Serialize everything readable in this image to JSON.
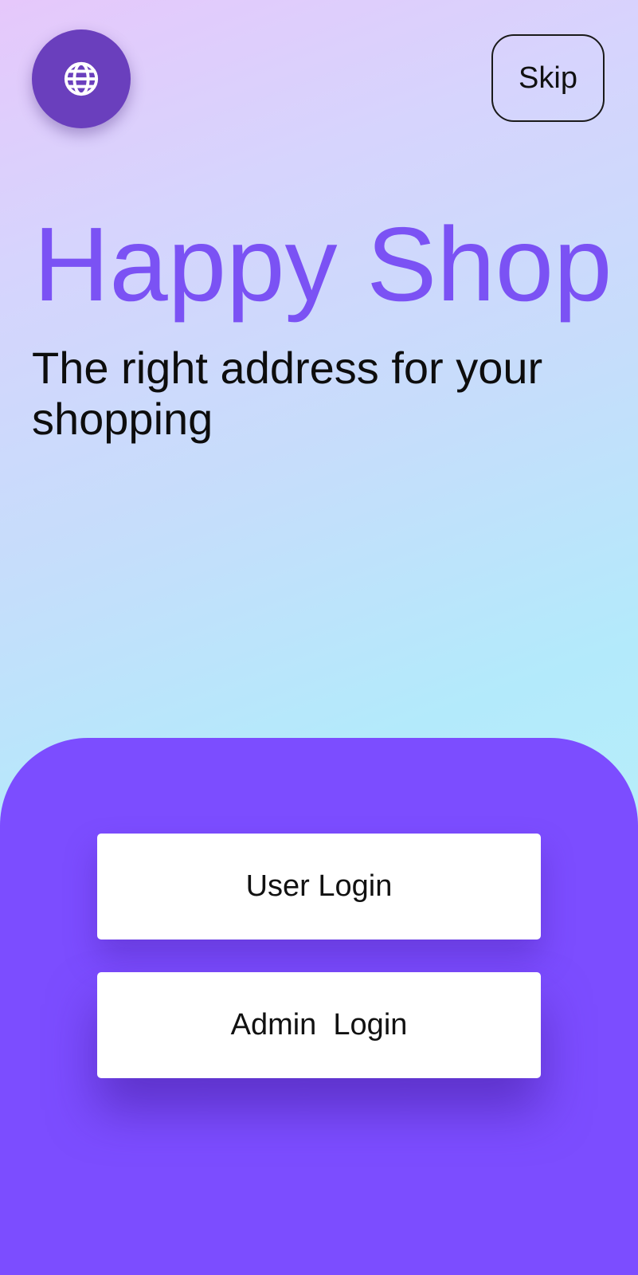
{
  "header": {
    "language_icon": "globe-icon",
    "skip_label": "Skip"
  },
  "hero": {
    "title": "Happy Shop",
    "subtitle": "The right address for your shopping"
  },
  "login_panel": {
    "user_login_label": "User Login",
    "admin_login_label": "Admin  Login"
  },
  "colors": {
    "accent": "#7c4dff",
    "title": "#7b52f4",
    "language_button": "#6a3fbd",
    "button_background": "#ffffff"
  }
}
